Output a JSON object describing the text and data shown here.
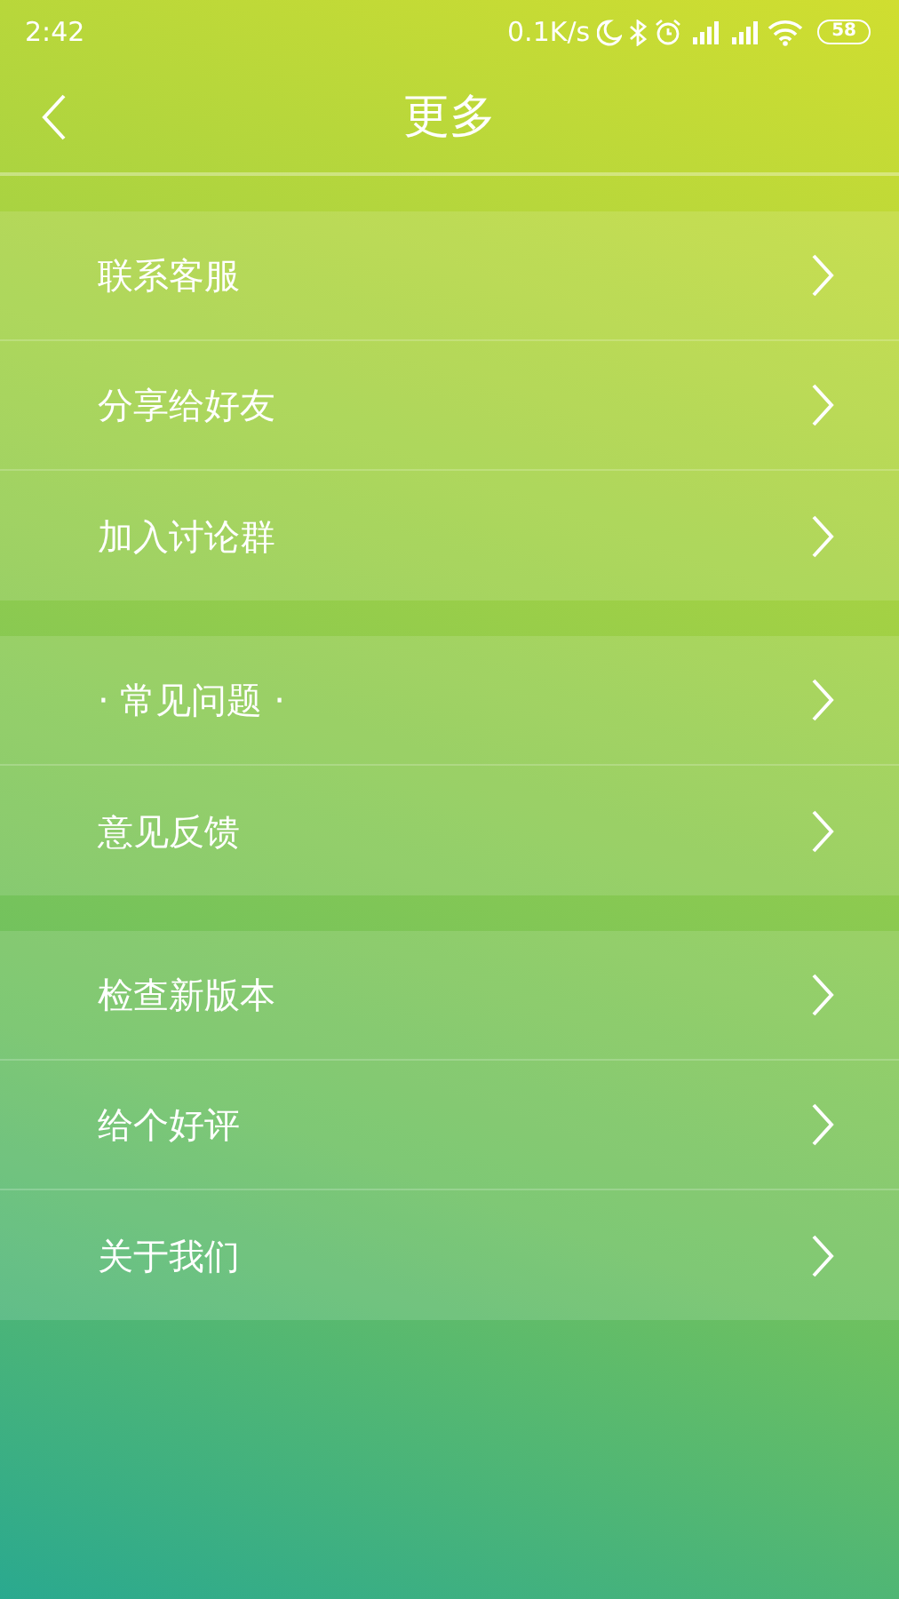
{
  "status_bar": {
    "time": "2:42",
    "network_speed": "0.1K/s",
    "battery": "58"
  },
  "header": {
    "title": "更多"
  },
  "groups": [
    {
      "items": [
        {
          "label": "联系客服"
        },
        {
          "label": "分享给好友"
        },
        {
          "label": "加入讨论群"
        }
      ]
    },
    {
      "items": [
        {
          "label": "· 常见问题 ·"
        },
        {
          "label": "意见反馈"
        }
      ]
    },
    {
      "items": [
        {
          "label": "检查新版本"
        },
        {
          "label": "给个好评"
        },
        {
          "label": "关于我们"
        }
      ]
    }
  ]
}
